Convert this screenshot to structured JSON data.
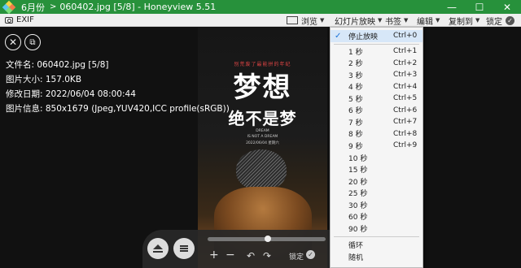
{
  "window": {
    "folder": "6月份",
    "separator": ">",
    "title": "060402.jpg [5/8] - Honeyview 5.51",
    "minimize": "—",
    "maximize": "☐",
    "close": "✕"
  },
  "toolbar": {
    "exif": "EXIF",
    "browse": "浏览",
    "slideshow": "幻灯片放映",
    "bookmark": "书签",
    "edit": "编辑",
    "copy_to": "复制到",
    "lock": "锁定"
  },
  "file_info": {
    "filename": "文件名: 060402.jpg [5/8]",
    "size": "图片大小: 157.0KB",
    "modified": "修改日期: 2022/06/04 08:00:44",
    "image_info": "图片信息: 850x1679 (Jpeg,YUV420,ICC profile(sRGB))"
  },
  "photo": {
    "tagline": "别荒废了最能拼的年纪",
    "headline1": "梦想",
    "headline2": "绝不是梦",
    "en1": "DREAM",
    "en2": "IS NOT A DREAM",
    "date": "2022/06/04  星期六"
  },
  "controls": {
    "lock": "锁定"
  },
  "slideshow_menu": {
    "items": [
      {
        "label": "停止放映",
        "key": "Ctrl+0",
        "checked": true
      },
      {
        "label": "1 秒",
        "key": "Ctrl+1"
      },
      {
        "label": "2 秒",
        "key": "Ctrl+2"
      },
      {
        "label": "3 秒",
        "key": "Ctrl+3"
      },
      {
        "label": "4 秒",
        "key": "Ctrl+4"
      },
      {
        "label": "5 秒",
        "key": "Ctrl+5"
      },
      {
        "label": "6 秒",
        "key": "Ctrl+6"
      },
      {
        "label": "7 秒",
        "key": "Ctrl+7"
      },
      {
        "label": "8 秒",
        "key": "Ctrl+8"
      },
      {
        "label": "9 秒",
        "key": "Ctrl+9"
      },
      {
        "label": "10 秒",
        "key": ""
      },
      {
        "label": "15 秒",
        "key": ""
      },
      {
        "label": "20 秒",
        "key": ""
      },
      {
        "label": "25 秒",
        "key": ""
      },
      {
        "label": "30 秒",
        "key": ""
      },
      {
        "label": "60 秒",
        "key": ""
      },
      {
        "label": "90 秒",
        "key": ""
      }
    ],
    "loop": "循环",
    "random": "随机"
  },
  "colors": {
    "titlebar": "#27913b",
    "menu_highlight": "#d7e7f8",
    "check": "#1a73d9"
  }
}
